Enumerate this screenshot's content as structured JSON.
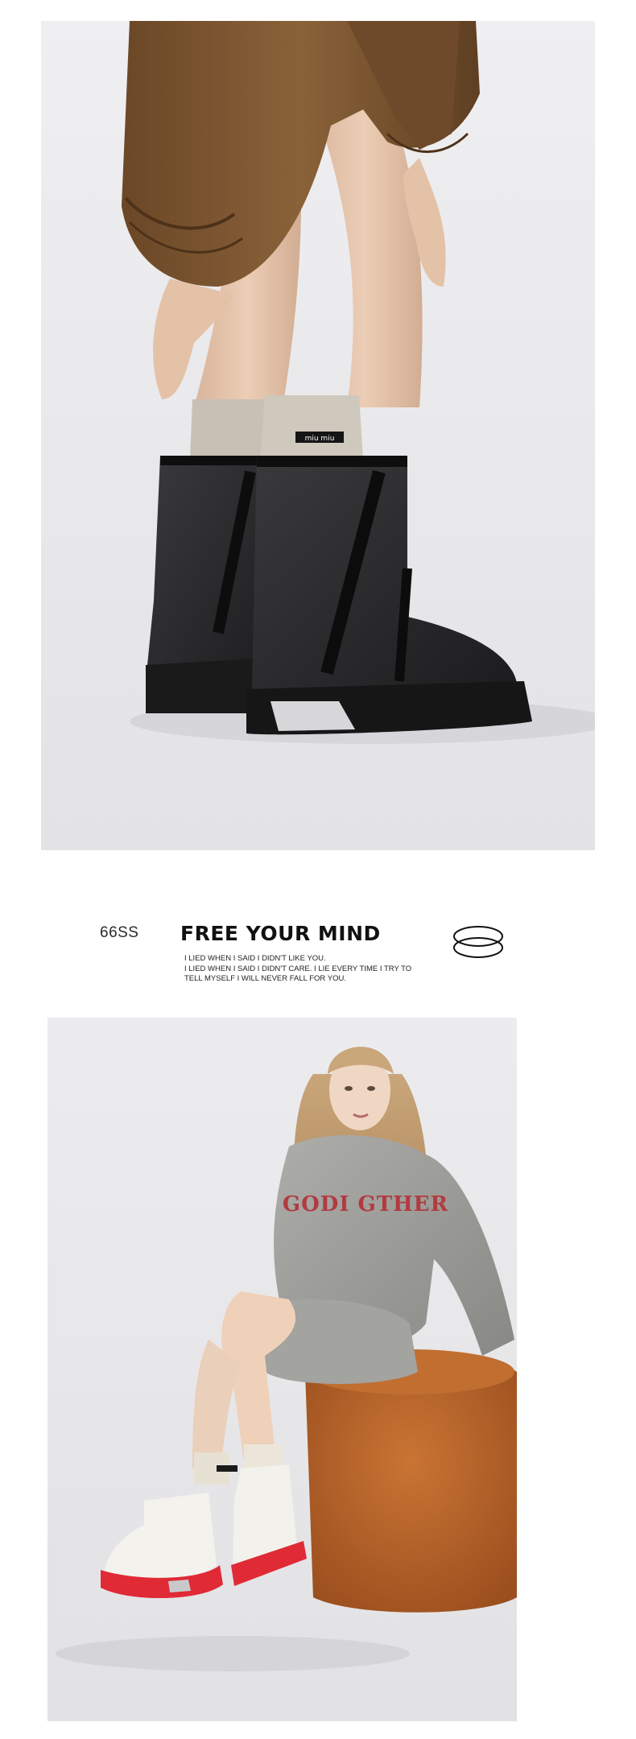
{
  "banner": {
    "code": "66SS",
    "headline": "FREE YOUR MIND",
    "tagline_lines": [
      "I LIED WHEN I SAID I DIDN'T LIKE YOU.",
      "I LIED WHEN I SAID I DIDN'T CARE. I LIE EVERY TIME I TRY TO",
      "TELL MYSELF I WILL NEVER FALL FOR YOU."
    ],
    "icon": "double-ring-icon"
  },
  "photos": {
    "top_boot_label": "miu miu",
    "bottom_sweater_text": "GODI GTHER"
  },
  "colors": {
    "background": "#ffffff",
    "boot_black": "#2a2a2c",
    "boot_white": "#f2f0ea",
    "sole_red": "#e02a36",
    "stool_rust": "#b8652c",
    "sweater_gray": "#9b9b98",
    "pants_brown": "#7a5432"
  }
}
